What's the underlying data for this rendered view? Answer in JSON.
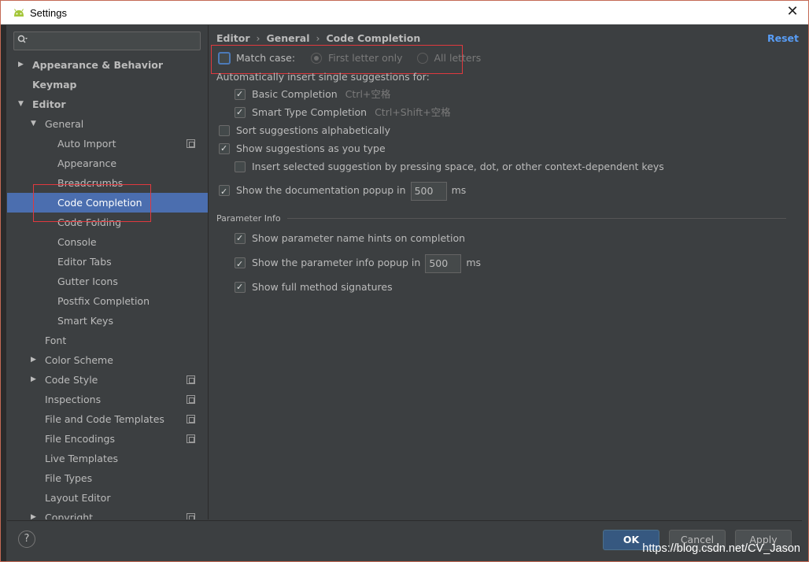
{
  "window": {
    "title": "Settings"
  },
  "sidebar": {
    "search_placeholder": "",
    "items": [
      {
        "label": "Appearance & Behavior",
        "level": 0,
        "arrow": "right",
        "bold": true
      },
      {
        "label": "Keymap",
        "level": 0,
        "arrow": "",
        "bold": true
      },
      {
        "label": "Editor",
        "level": 0,
        "arrow": "down",
        "bold": true
      },
      {
        "label": "General",
        "level": 1,
        "arrow": "down"
      },
      {
        "label": "Auto Import",
        "level": 2,
        "badge": true
      },
      {
        "label": "Appearance",
        "level": 2
      },
      {
        "label": "Breadcrumbs",
        "level": 2
      },
      {
        "label": "Code Completion",
        "level": 2,
        "selected": true
      },
      {
        "label": "Code Folding",
        "level": 2
      },
      {
        "label": "Console",
        "level": 2
      },
      {
        "label": "Editor Tabs",
        "level": 2
      },
      {
        "label": "Gutter Icons",
        "level": 2
      },
      {
        "label": "Postfix Completion",
        "level": 2
      },
      {
        "label": "Smart Keys",
        "level": 2
      },
      {
        "label": "Font",
        "level": 1
      },
      {
        "label": "Color Scheme",
        "level": 1,
        "arrow": "right"
      },
      {
        "label": "Code Style",
        "level": 1,
        "arrow": "right",
        "badge": true
      },
      {
        "label": "Inspections",
        "level": 1,
        "badge": true
      },
      {
        "label": "File and Code Templates",
        "level": 1,
        "badge": true
      },
      {
        "label": "File Encodings",
        "level": 1,
        "badge": true
      },
      {
        "label": "Live Templates",
        "level": 1
      },
      {
        "label": "File Types",
        "level": 1
      },
      {
        "label": "Layout Editor",
        "level": 1
      },
      {
        "label": "Copyright",
        "level": 1,
        "arrow": "right",
        "badge": true
      }
    ]
  },
  "breadcrumb": {
    "part1": "Editor",
    "part2": "General",
    "part3": "Code Completion",
    "sep": "›"
  },
  "reset_label": "Reset",
  "options": {
    "match_case": "Match case:",
    "first_letter_only": "First letter only",
    "all_letters": "All letters",
    "auto_insert_heading": "Automatically insert single suggestions for:",
    "basic_completion": "Basic Completion",
    "basic_completion_shortcut": "Ctrl+空格",
    "smart_type_completion": "Smart Type Completion",
    "smart_type_shortcut": "Ctrl+Shift+空格",
    "sort_alpha": "Sort suggestions alphabetically",
    "show_as_you_type": "Show suggestions as you type",
    "insert_selected": "Insert selected suggestion by pressing space, dot, or other context-dependent keys",
    "show_doc_popup": "Show the documentation popup in",
    "doc_popup_value": "500",
    "doc_popup_unit": "ms"
  },
  "parameter_info": {
    "title": "Parameter Info",
    "show_hints": "Show parameter name hints on completion",
    "show_popup": "Show the parameter info popup in",
    "popup_value": "500",
    "popup_unit": "ms",
    "show_full_sig": "Show full method signatures"
  },
  "footer": {
    "help": "?",
    "ok": "OK",
    "cancel": "Cancel",
    "apply": "Apply",
    "watermark": "https://blog.csdn.net/CV_Jason"
  },
  "colors": {
    "selection": "#4b6eaf",
    "link": "#589df6",
    "highlight_box": "#e0393e",
    "background": "#3c3f41"
  }
}
